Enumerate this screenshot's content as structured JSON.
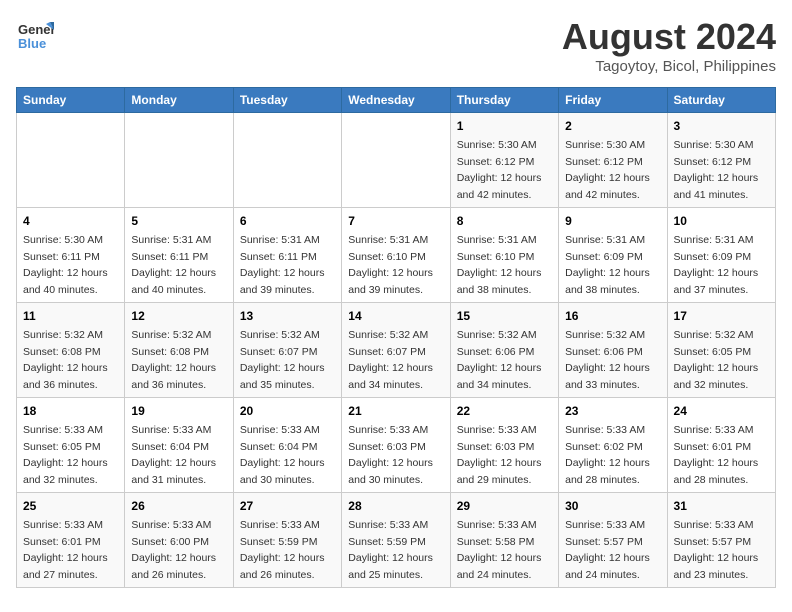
{
  "header": {
    "logo_general": "General",
    "logo_blue": "Blue",
    "month_year": "August 2024",
    "location": "Tagoytoy, Bicol, Philippines"
  },
  "days_of_week": [
    "Sunday",
    "Monday",
    "Tuesday",
    "Wednesday",
    "Thursday",
    "Friday",
    "Saturday"
  ],
  "weeks": [
    [
      {
        "day": "",
        "info": ""
      },
      {
        "day": "",
        "info": ""
      },
      {
        "day": "",
        "info": ""
      },
      {
        "day": "",
        "info": ""
      },
      {
        "day": "1",
        "info": "Sunrise: 5:30 AM\nSunset: 6:12 PM\nDaylight: 12 hours\nand 42 minutes."
      },
      {
        "day": "2",
        "info": "Sunrise: 5:30 AM\nSunset: 6:12 PM\nDaylight: 12 hours\nand 42 minutes."
      },
      {
        "day": "3",
        "info": "Sunrise: 5:30 AM\nSunset: 6:12 PM\nDaylight: 12 hours\nand 41 minutes."
      }
    ],
    [
      {
        "day": "4",
        "info": "Sunrise: 5:30 AM\nSunset: 6:11 PM\nDaylight: 12 hours\nand 40 minutes."
      },
      {
        "day": "5",
        "info": "Sunrise: 5:31 AM\nSunset: 6:11 PM\nDaylight: 12 hours\nand 40 minutes."
      },
      {
        "day": "6",
        "info": "Sunrise: 5:31 AM\nSunset: 6:11 PM\nDaylight: 12 hours\nand 39 minutes."
      },
      {
        "day": "7",
        "info": "Sunrise: 5:31 AM\nSunset: 6:10 PM\nDaylight: 12 hours\nand 39 minutes."
      },
      {
        "day": "8",
        "info": "Sunrise: 5:31 AM\nSunset: 6:10 PM\nDaylight: 12 hours\nand 38 minutes."
      },
      {
        "day": "9",
        "info": "Sunrise: 5:31 AM\nSunset: 6:09 PM\nDaylight: 12 hours\nand 38 minutes."
      },
      {
        "day": "10",
        "info": "Sunrise: 5:31 AM\nSunset: 6:09 PM\nDaylight: 12 hours\nand 37 minutes."
      }
    ],
    [
      {
        "day": "11",
        "info": "Sunrise: 5:32 AM\nSunset: 6:08 PM\nDaylight: 12 hours\nand 36 minutes."
      },
      {
        "day": "12",
        "info": "Sunrise: 5:32 AM\nSunset: 6:08 PM\nDaylight: 12 hours\nand 36 minutes."
      },
      {
        "day": "13",
        "info": "Sunrise: 5:32 AM\nSunset: 6:07 PM\nDaylight: 12 hours\nand 35 minutes."
      },
      {
        "day": "14",
        "info": "Sunrise: 5:32 AM\nSunset: 6:07 PM\nDaylight: 12 hours\nand 34 minutes."
      },
      {
        "day": "15",
        "info": "Sunrise: 5:32 AM\nSunset: 6:06 PM\nDaylight: 12 hours\nand 34 minutes."
      },
      {
        "day": "16",
        "info": "Sunrise: 5:32 AM\nSunset: 6:06 PM\nDaylight: 12 hours\nand 33 minutes."
      },
      {
        "day": "17",
        "info": "Sunrise: 5:32 AM\nSunset: 6:05 PM\nDaylight: 12 hours\nand 32 minutes."
      }
    ],
    [
      {
        "day": "18",
        "info": "Sunrise: 5:33 AM\nSunset: 6:05 PM\nDaylight: 12 hours\nand 32 minutes."
      },
      {
        "day": "19",
        "info": "Sunrise: 5:33 AM\nSunset: 6:04 PM\nDaylight: 12 hours\nand 31 minutes."
      },
      {
        "day": "20",
        "info": "Sunrise: 5:33 AM\nSunset: 6:04 PM\nDaylight: 12 hours\nand 30 minutes."
      },
      {
        "day": "21",
        "info": "Sunrise: 5:33 AM\nSunset: 6:03 PM\nDaylight: 12 hours\nand 30 minutes."
      },
      {
        "day": "22",
        "info": "Sunrise: 5:33 AM\nSunset: 6:03 PM\nDaylight: 12 hours\nand 29 minutes."
      },
      {
        "day": "23",
        "info": "Sunrise: 5:33 AM\nSunset: 6:02 PM\nDaylight: 12 hours\nand 28 minutes."
      },
      {
        "day": "24",
        "info": "Sunrise: 5:33 AM\nSunset: 6:01 PM\nDaylight: 12 hours\nand 28 minutes."
      }
    ],
    [
      {
        "day": "25",
        "info": "Sunrise: 5:33 AM\nSunset: 6:01 PM\nDaylight: 12 hours\nand 27 minutes."
      },
      {
        "day": "26",
        "info": "Sunrise: 5:33 AM\nSunset: 6:00 PM\nDaylight: 12 hours\nand 26 minutes."
      },
      {
        "day": "27",
        "info": "Sunrise: 5:33 AM\nSunset: 5:59 PM\nDaylight: 12 hours\nand 26 minutes."
      },
      {
        "day": "28",
        "info": "Sunrise: 5:33 AM\nSunset: 5:59 PM\nDaylight: 12 hours\nand 25 minutes."
      },
      {
        "day": "29",
        "info": "Sunrise: 5:33 AM\nSunset: 5:58 PM\nDaylight: 12 hours\nand 24 minutes."
      },
      {
        "day": "30",
        "info": "Sunrise: 5:33 AM\nSunset: 5:57 PM\nDaylight: 12 hours\nand 24 minutes."
      },
      {
        "day": "31",
        "info": "Sunrise: 5:33 AM\nSunset: 5:57 PM\nDaylight: 12 hours\nand 23 minutes."
      }
    ]
  ]
}
